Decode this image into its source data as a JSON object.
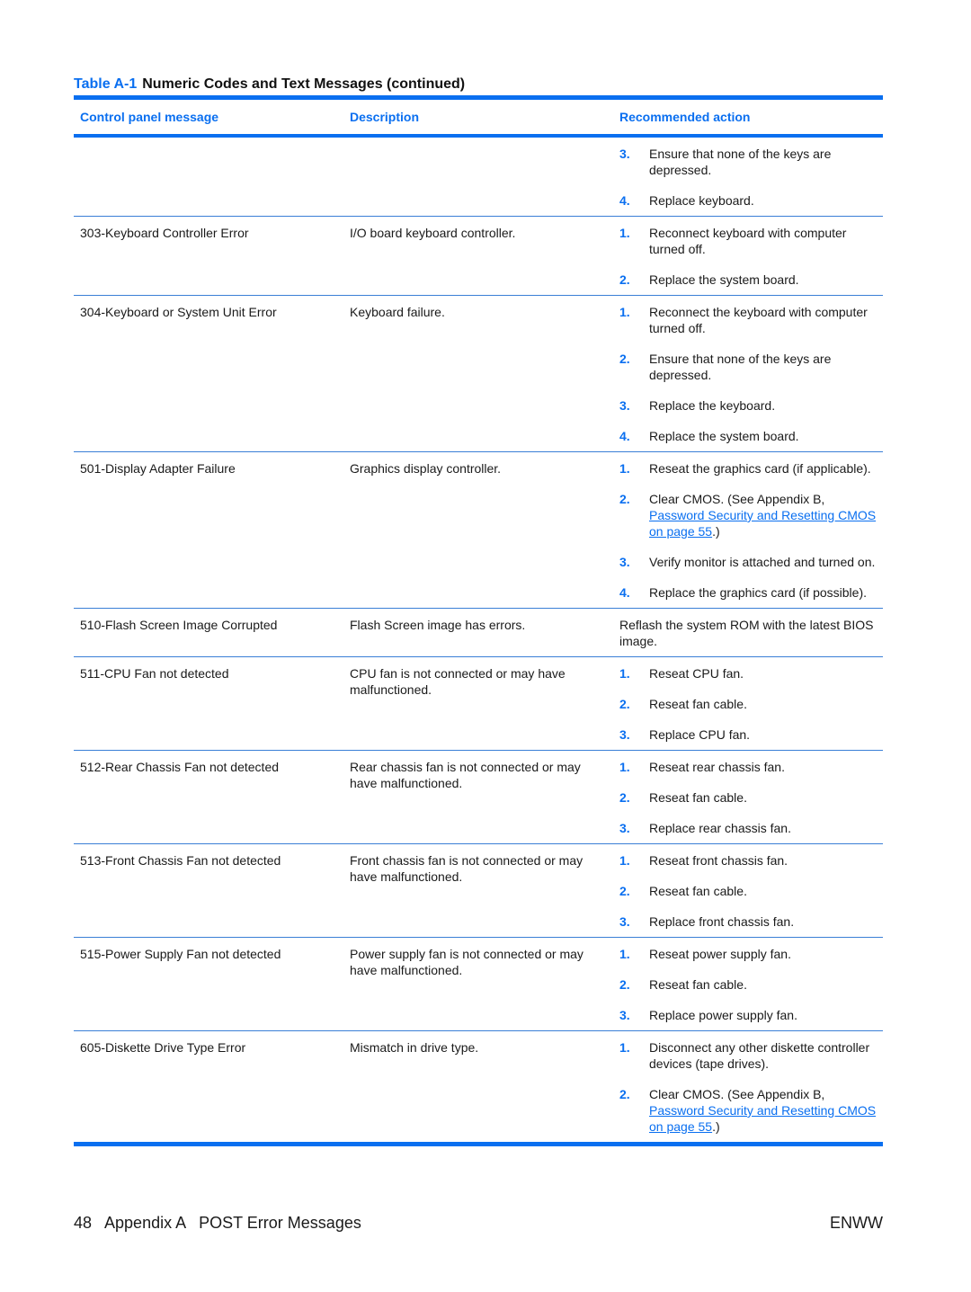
{
  "caption": {
    "label": "Table A-1",
    "title": "Numeric Codes and Text Messages (continued)"
  },
  "headers": [
    "Control panel message",
    "Description",
    "Recommended action"
  ],
  "rows": [
    {
      "message": "",
      "description": "",
      "steps": [
        {
          "n": "3.",
          "text": "Ensure that none of the keys are depressed."
        },
        {
          "n": "4.",
          "text": "Replace keyboard."
        }
      ]
    },
    {
      "message": "303-Keyboard Controller Error",
      "description": "I/O board keyboard controller.",
      "steps": [
        {
          "n": "1.",
          "text": "Reconnect keyboard with computer turned off."
        },
        {
          "n": "2.",
          "text": "Replace the system board."
        }
      ]
    },
    {
      "message": "304-Keyboard or System Unit Error",
      "description": "Keyboard failure.",
      "steps": [
        {
          "n": "1.",
          "text": "Reconnect the keyboard with computer turned off."
        },
        {
          "n": "2.",
          "text": "Ensure that none of the keys are depressed."
        },
        {
          "n": "3.",
          "text": "Replace the keyboard."
        },
        {
          "n": "4.",
          "text": "Replace the system board."
        }
      ]
    },
    {
      "message": "501-Display Adapter Failure",
      "description": "Graphics display controller.",
      "steps": [
        {
          "n": "1.",
          "text": "Reseat the graphics card (if applicable)."
        },
        {
          "n": "2.",
          "text": "Clear CMOS. (See Appendix B, ",
          "link": "Password Security and Resetting CMOS on page 55",
          "after": ".)"
        },
        {
          "n": "3.",
          "text": "Verify monitor is attached and turned on."
        },
        {
          "n": "4.",
          "text": "Replace the graphics card (if possible)."
        }
      ]
    },
    {
      "message": "510-Flash Screen Image Corrupted",
      "description": "Flash Screen image has errors.",
      "action": "Reflash the system ROM with the latest BIOS image."
    },
    {
      "message": "511-CPU Fan not detected",
      "description": "CPU fan is not connected or may have malfunctioned.",
      "steps": [
        {
          "n": "1.",
          "text": "Reseat CPU fan."
        },
        {
          "n": "2.",
          "text": "Reseat fan cable."
        },
        {
          "n": "3.",
          "text": "Replace CPU fan."
        }
      ]
    },
    {
      "message": "512-Rear Chassis Fan not detected",
      "description": "Rear chassis fan is not connected or may have malfunctioned.",
      "steps": [
        {
          "n": "1.",
          "text": "Reseat rear chassis fan."
        },
        {
          "n": "2.",
          "text": "Reseat fan cable."
        },
        {
          "n": "3.",
          "text": "Replace rear chassis fan."
        }
      ]
    },
    {
      "message": "513-Front Chassis Fan not detected",
      "description": "Front chassis fan is not connected or may have malfunctioned.",
      "steps": [
        {
          "n": "1.",
          "text": "Reseat front chassis fan."
        },
        {
          "n": "2.",
          "text": "Reseat fan cable."
        },
        {
          "n": "3.",
          "text": "Replace front chassis fan."
        }
      ]
    },
    {
      "message": "515-Power Supply Fan not detected",
      "description": "Power supply fan is not connected or may have malfunctioned.",
      "steps": [
        {
          "n": "1.",
          "text": "Reseat power supply fan."
        },
        {
          "n": "2.",
          "text": "Reseat fan cable."
        },
        {
          "n": "3.",
          "text": "Replace power supply fan."
        }
      ]
    },
    {
      "message": "605-Diskette Drive Type Error",
      "description": "Mismatch in drive type.",
      "steps": [
        {
          "n": "1.",
          "text": "Disconnect any other diskette controller devices (tape drives)."
        },
        {
          "n": "2.",
          "text": "Clear CMOS. (See Appendix B, ",
          "link": "Password Security and Resetting CMOS on page 55",
          "after": ".)"
        }
      ]
    }
  ],
  "footer": {
    "page": "48",
    "section": "Appendix A   POST Error Messages",
    "right": "ENWW"
  }
}
